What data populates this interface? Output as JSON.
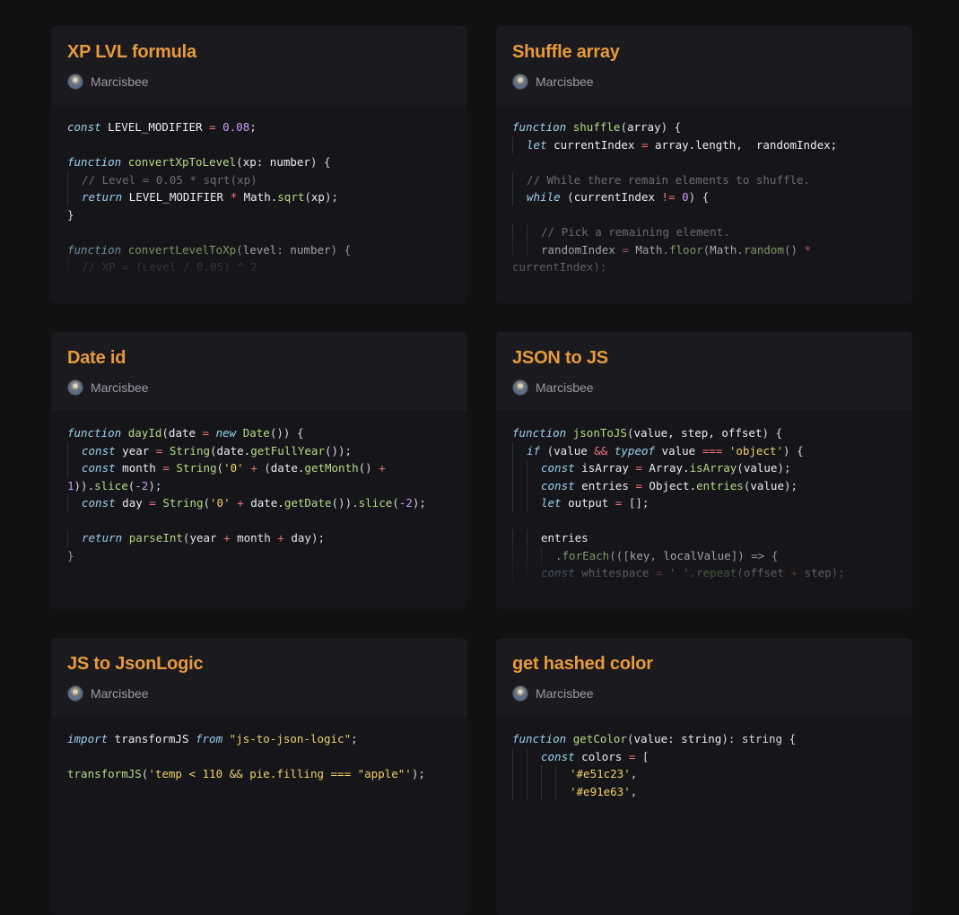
{
  "cards": [
    {
      "title": "XP LVL formula",
      "author": "Marcisbee",
      "lines": [
        [
          [
            0,
            "kw",
            "const"
          ],
          [
            0,
            "plain",
            " LEVEL_MODIFIER "
          ],
          [
            0,
            "op",
            "="
          ],
          [
            0,
            "plain",
            " "
          ],
          [
            0,
            "num",
            "0.08"
          ],
          [
            0,
            "punc",
            ";"
          ]
        ],
        [],
        [
          [
            0,
            "kw",
            "function"
          ],
          [
            0,
            "plain",
            " "
          ],
          [
            0,
            "fn",
            "convertXpToLevel"
          ],
          [
            0,
            "punc",
            "("
          ],
          [
            0,
            "plain",
            "xp: number"
          ],
          [
            0,
            "punc",
            ") {"
          ]
        ],
        [
          [
            1,
            "com",
            "// Level = 0.05 * sqrt(xp)"
          ]
        ],
        [
          [
            1,
            "kw",
            "return"
          ],
          [
            1,
            "plain",
            " LEVEL_MODIFIER "
          ],
          [
            1,
            "op",
            "*"
          ],
          [
            1,
            "plain",
            " Math."
          ],
          [
            1,
            "fn",
            "sqrt"
          ],
          [
            1,
            "punc",
            "("
          ],
          [
            1,
            "plain",
            "xp"
          ],
          [
            1,
            "punc",
            ");"
          ]
        ],
        [
          [
            0,
            "punc",
            "}"
          ]
        ],
        [],
        [
          [
            0,
            "kw",
            "function"
          ],
          [
            0,
            "plain",
            " "
          ],
          [
            0,
            "fn",
            "convertLevelToXp"
          ],
          [
            0,
            "punc",
            "("
          ],
          [
            0,
            "plain",
            "level: number"
          ],
          [
            0,
            "punc",
            ") {"
          ]
        ],
        [
          [
            1,
            "com",
            "// XP = (Level / 0.05) ^ 2"
          ]
        ]
      ]
    },
    {
      "title": "Shuffle array",
      "author": "Marcisbee",
      "lines": [
        [
          [
            0,
            "kw",
            "function"
          ],
          [
            0,
            "plain",
            " "
          ],
          [
            0,
            "fn",
            "shuffle"
          ],
          [
            0,
            "punc",
            "("
          ],
          [
            0,
            "plain",
            "array"
          ],
          [
            0,
            "punc",
            ") {"
          ]
        ],
        [
          [
            1,
            "kw",
            "let"
          ],
          [
            1,
            "plain",
            " currentIndex "
          ],
          [
            1,
            "op",
            "="
          ],
          [
            1,
            "plain",
            " array.length,  randomIndex;"
          ]
        ],
        [],
        [
          [
            1,
            "com",
            "// While there remain elements to shuffle."
          ]
        ],
        [
          [
            1,
            "kw",
            "while"
          ],
          [
            1,
            "plain",
            " "
          ],
          [
            1,
            "punc",
            "("
          ],
          [
            1,
            "plain",
            "currentIndex "
          ],
          [
            1,
            "op",
            "!="
          ],
          [
            1,
            "plain",
            " "
          ],
          [
            1,
            "num",
            "0"
          ],
          [
            1,
            "punc",
            ") {"
          ]
        ],
        [],
        [
          [
            2,
            "com",
            "// Pick a remaining element."
          ]
        ],
        [
          [
            2,
            "plain",
            "randomIndex "
          ],
          [
            2,
            "op",
            "="
          ],
          [
            2,
            "plain",
            " Math."
          ],
          [
            2,
            "fn",
            "floor"
          ],
          [
            2,
            "punc",
            "("
          ],
          [
            2,
            "plain",
            "Math."
          ],
          [
            2,
            "fn",
            "random"
          ],
          [
            2,
            "punc",
            "() "
          ],
          [
            2,
            "op",
            "*"
          ]
        ],
        [
          [
            0,
            "plain",
            "currentIndex"
          ],
          [
            0,
            "punc",
            ");"
          ]
        ]
      ]
    },
    {
      "title": "Date id",
      "author": "Marcisbee",
      "lines": [
        [
          [
            0,
            "kw",
            "function"
          ],
          [
            0,
            "plain",
            " "
          ],
          [
            0,
            "fn",
            "dayId"
          ],
          [
            0,
            "punc",
            "("
          ],
          [
            0,
            "plain",
            "date "
          ],
          [
            0,
            "op",
            "="
          ],
          [
            0,
            "plain",
            " "
          ],
          [
            0,
            "kw",
            "new"
          ],
          [
            0,
            "plain",
            " "
          ],
          [
            0,
            "fn",
            "Date"
          ],
          [
            0,
            "punc",
            "()) {"
          ]
        ],
        [
          [
            1,
            "kw",
            "const"
          ],
          [
            1,
            "plain",
            " year "
          ],
          [
            1,
            "op",
            "="
          ],
          [
            1,
            "plain",
            " "
          ],
          [
            1,
            "fn",
            "String"
          ],
          [
            1,
            "punc",
            "("
          ],
          [
            1,
            "plain",
            "date."
          ],
          [
            1,
            "fn",
            "getFullYear"
          ],
          [
            1,
            "punc",
            "());"
          ]
        ],
        [
          [
            1,
            "kw",
            "const"
          ],
          [
            1,
            "plain",
            " month "
          ],
          [
            1,
            "op",
            "="
          ],
          [
            1,
            "plain",
            " "
          ],
          [
            1,
            "fn",
            "String"
          ],
          [
            1,
            "punc",
            "("
          ],
          [
            1,
            "str",
            "'0'"
          ],
          [
            1,
            "plain",
            " "
          ],
          [
            1,
            "op",
            "+"
          ],
          [
            1,
            "plain",
            " "
          ],
          [
            1,
            "punc",
            "("
          ],
          [
            1,
            "plain",
            "date."
          ],
          [
            1,
            "fn",
            "getMonth"
          ],
          [
            1,
            "punc",
            "() "
          ],
          [
            1,
            "op",
            "+"
          ]
        ],
        [
          [
            0,
            "num",
            "1"
          ],
          [
            0,
            "punc",
            "))."
          ],
          [
            0,
            "fn",
            "slice"
          ],
          [
            0,
            "punc",
            "("
          ],
          [
            0,
            "num",
            "-2"
          ],
          [
            0,
            "punc",
            ");"
          ]
        ],
        [
          [
            1,
            "kw",
            "const"
          ],
          [
            1,
            "plain",
            " day "
          ],
          [
            1,
            "op",
            "="
          ],
          [
            1,
            "plain",
            " "
          ],
          [
            1,
            "fn",
            "String"
          ],
          [
            1,
            "punc",
            "("
          ],
          [
            1,
            "str",
            "'0'"
          ],
          [
            1,
            "plain",
            " "
          ],
          [
            1,
            "op",
            "+"
          ],
          [
            1,
            "plain",
            " date."
          ],
          [
            1,
            "fn",
            "getDate"
          ],
          [
            1,
            "punc",
            "())."
          ],
          [
            1,
            "fn",
            "slice"
          ],
          [
            1,
            "punc",
            "("
          ],
          [
            1,
            "num",
            "-2"
          ],
          [
            1,
            "punc",
            ");"
          ]
        ],
        [],
        [
          [
            1,
            "kw",
            "return"
          ],
          [
            1,
            "plain",
            " "
          ],
          [
            1,
            "fn",
            "parseInt"
          ],
          [
            1,
            "punc",
            "("
          ],
          [
            1,
            "plain",
            "year "
          ],
          [
            1,
            "op",
            "+"
          ],
          [
            1,
            "plain",
            " month "
          ],
          [
            1,
            "op",
            "+"
          ],
          [
            1,
            "plain",
            " day"
          ],
          [
            1,
            "punc",
            ");"
          ]
        ],
        [
          [
            0,
            "punc",
            "}"
          ]
        ]
      ]
    },
    {
      "title": "JSON to JS",
      "author": "Marcisbee",
      "lines": [
        [
          [
            0,
            "kw",
            "function"
          ],
          [
            0,
            "plain",
            " "
          ],
          [
            0,
            "fn",
            "jsonToJS"
          ],
          [
            0,
            "punc",
            "("
          ],
          [
            0,
            "plain",
            "value, step, offset"
          ],
          [
            0,
            "punc",
            ") {"
          ]
        ],
        [
          [
            1,
            "kw",
            "if"
          ],
          [
            1,
            "plain",
            " "
          ],
          [
            1,
            "punc",
            "("
          ],
          [
            1,
            "plain",
            "value "
          ],
          [
            1,
            "op",
            "&&"
          ],
          [
            1,
            "plain",
            " "
          ],
          [
            1,
            "kw",
            "typeof"
          ],
          [
            1,
            "plain",
            " value "
          ],
          [
            1,
            "op",
            "==="
          ],
          [
            1,
            "plain",
            " "
          ],
          [
            1,
            "str",
            "'object'"
          ],
          [
            1,
            "punc",
            ") {"
          ]
        ],
        [
          [
            2,
            "kw",
            "const"
          ],
          [
            2,
            "plain",
            " isArray "
          ],
          [
            2,
            "op",
            "="
          ],
          [
            2,
            "plain",
            " Array."
          ],
          [
            2,
            "fn",
            "isArray"
          ],
          [
            2,
            "punc",
            "("
          ],
          [
            2,
            "plain",
            "value"
          ],
          [
            2,
            "punc",
            ");"
          ]
        ],
        [
          [
            2,
            "kw",
            "const"
          ],
          [
            2,
            "plain",
            " entries "
          ],
          [
            2,
            "op",
            "="
          ],
          [
            2,
            "plain",
            " Object."
          ],
          [
            2,
            "fn",
            "entries"
          ],
          [
            2,
            "punc",
            "("
          ],
          [
            2,
            "plain",
            "value"
          ],
          [
            2,
            "punc",
            ");"
          ]
        ],
        [
          [
            2,
            "kw",
            "let"
          ],
          [
            2,
            "plain",
            " output "
          ],
          [
            2,
            "op",
            "="
          ],
          [
            2,
            "plain",
            " "
          ],
          [
            2,
            "punc",
            "[];"
          ]
        ],
        [],
        [
          [
            2,
            "plain",
            "entries"
          ]
        ],
        [
          [
            3,
            "punc",
            "."
          ],
          [
            3,
            "fn",
            "forEach"
          ],
          [
            3,
            "punc",
            "((["
          ],
          [
            3,
            "plain",
            "key, localValue"
          ],
          [
            3,
            "punc",
            "]) => {"
          ]
        ],
        [
          [
            4,
            "kw",
            "const"
          ],
          [
            4,
            "plain",
            " whitespace "
          ],
          [
            4,
            "op",
            "="
          ],
          [
            4,
            "plain",
            " "
          ],
          [
            4,
            "str",
            "' '"
          ],
          [
            4,
            "punc",
            "."
          ],
          [
            4,
            "fn",
            "repeat"
          ],
          [
            4,
            "punc",
            "("
          ],
          [
            4,
            "plain",
            "offset "
          ],
          [
            4,
            "op",
            "+"
          ],
          [
            4,
            "plain",
            " step"
          ],
          [
            4,
            "punc",
            ");"
          ]
        ]
      ]
    },
    {
      "title": "JS to JsonLogic",
      "author": "Marcisbee",
      "lines": [
        [
          [
            0,
            "kw",
            "import"
          ],
          [
            0,
            "plain",
            " transformJS "
          ],
          [
            0,
            "kw",
            "from"
          ],
          [
            0,
            "plain",
            " "
          ],
          [
            0,
            "str",
            "\"js-to-json-logic\""
          ],
          [
            0,
            "punc",
            ";"
          ]
        ],
        [],
        [
          [
            0,
            "fn",
            "transformJS"
          ],
          [
            0,
            "punc",
            "("
          ],
          [
            0,
            "str",
            "'temp < 110 && pie.filling === \"apple\"'"
          ],
          [
            0,
            "punc",
            ");"
          ]
        ]
      ]
    },
    {
      "title": "get hashed color",
      "author": "Marcisbee",
      "lines": [
        [
          [
            0,
            "kw",
            "function"
          ],
          [
            0,
            "plain",
            " "
          ],
          [
            0,
            "fn",
            "getColor"
          ],
          [
            0,
            "punc",
            "("
          ],
          [
            0,
            "plain",
            "value: string"
          ],
          [
            0,
            "punc",
            "): string {"
          ]
        ],
        [
          [
            4,
            "kw",
            "const"
          ],
          [
            4,
            "plain",
            " colors "
          ],
          [
            4,
            "op",
            "="
          ],
          [
            4,
            "plain",
            " "
          ],
          [
            4,
            "punc",
            "["
          ]
        ],
        [
          [
            8,
            "str",
            "'#e51c23'"
          ],
          [
            8,
            "punc",
            ","
          ]
        ],
        [
          [
            8,
            "str",
            "'#e91e63'"
          ],
          [
            8,
            "punc",
            ","
          ]
        ]
      ]
    }
  ]
}
